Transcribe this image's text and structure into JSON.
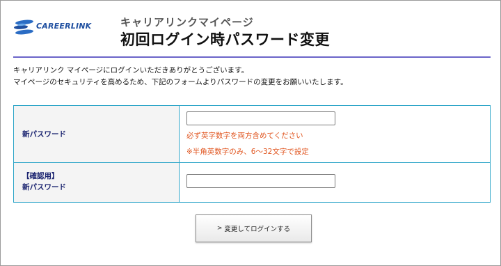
{
  "header": {
    "logo_text": "CAREERLINK",
    "sub_title": "キャリアリンクマイページ",
    "page_title": "初回ログイン時パスワード変更"
  },
  "intro": {
    "line1": "キャリアリンク マイページにログインいただきありがとうございます。",
    "line2": "マイページのセキュリティを高めるため、下記のフォームよりパスワードの変更をお願いいたします。"
  },
  "form": {
    "new_password": {
      "label": "新パスワード",
      "value": "",
      "hint1": "必ず英字数字を両方含めてください",
      "hint2": "※半角英数字のみ、6〜32文字で設定"
    },
    "confirm_password": {
      "label_line1": "【確認用】",
      "label_line2": "新パスワード",
      "value": ""
    }
  },
  "submit": {
    "arrow": ">",
    "label": "変更してログインする"
  },
  "colors": {
    "accent_rule": "#6b64c9",
    "table_border": "#2fa6c9",
    "label_text": "#1b2470",
    "hint_text": "#e0541e",
    "logo_blue": "#1f4fa0"
  }
}
